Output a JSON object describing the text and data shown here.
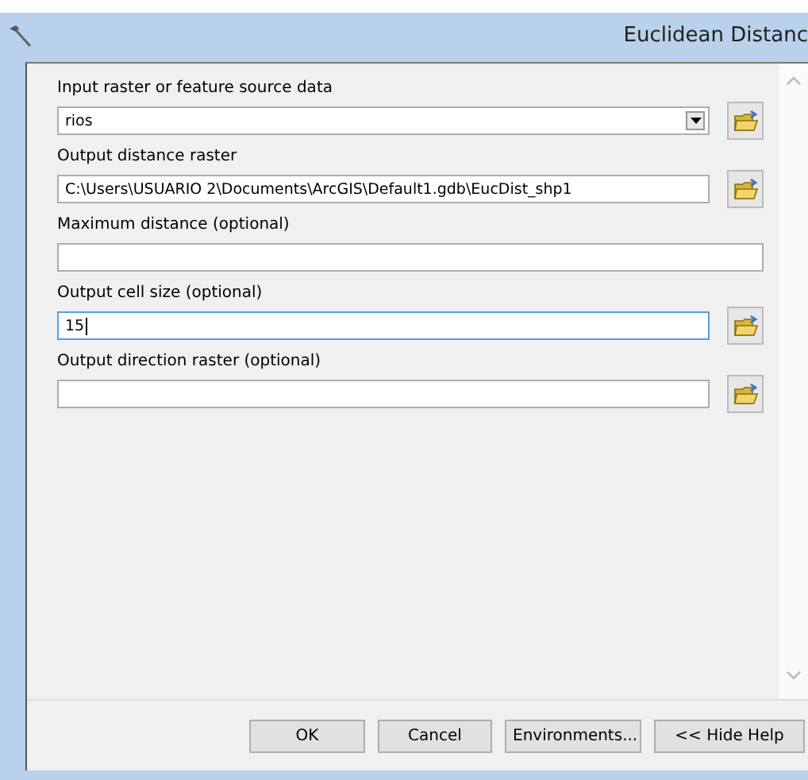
{
  "window": {
    "title": "Euclidean Distanc"
  },
  "parameters": [
    {
      "label": "Input raster or feature source data",
      "value": "rios",
      "kind": "dropdown",
      "browse": true,
      "focused": false
    },
    {
      "label": "Output distance raster",
      "value": "C:\\Users\\USUARIO 2\\Documents\\ArcGIS\\Default1.gdb\\EucDist_shp1",
      "kind": "text",
      "browse": true,
      "focused": false
    },
    {
      "label": "Maximum distance (optional)",
      "kind": "text",
      "browse": false,
      "focused": false
    },
    {
      "label": "Output cell size (optional)",
      "value": "15",
      "kind": "text",
      "browse": true,
      "focused": true
    },
    {
      "label": "Output direction raster (optional)",
      "kind": "text",
      "browse": true,
      "focused": false
    }
  ],
  "buttons": [
    "OK",
    "Cancel",
    "Environments...",
    "<< Hide Help"
  ]
}
